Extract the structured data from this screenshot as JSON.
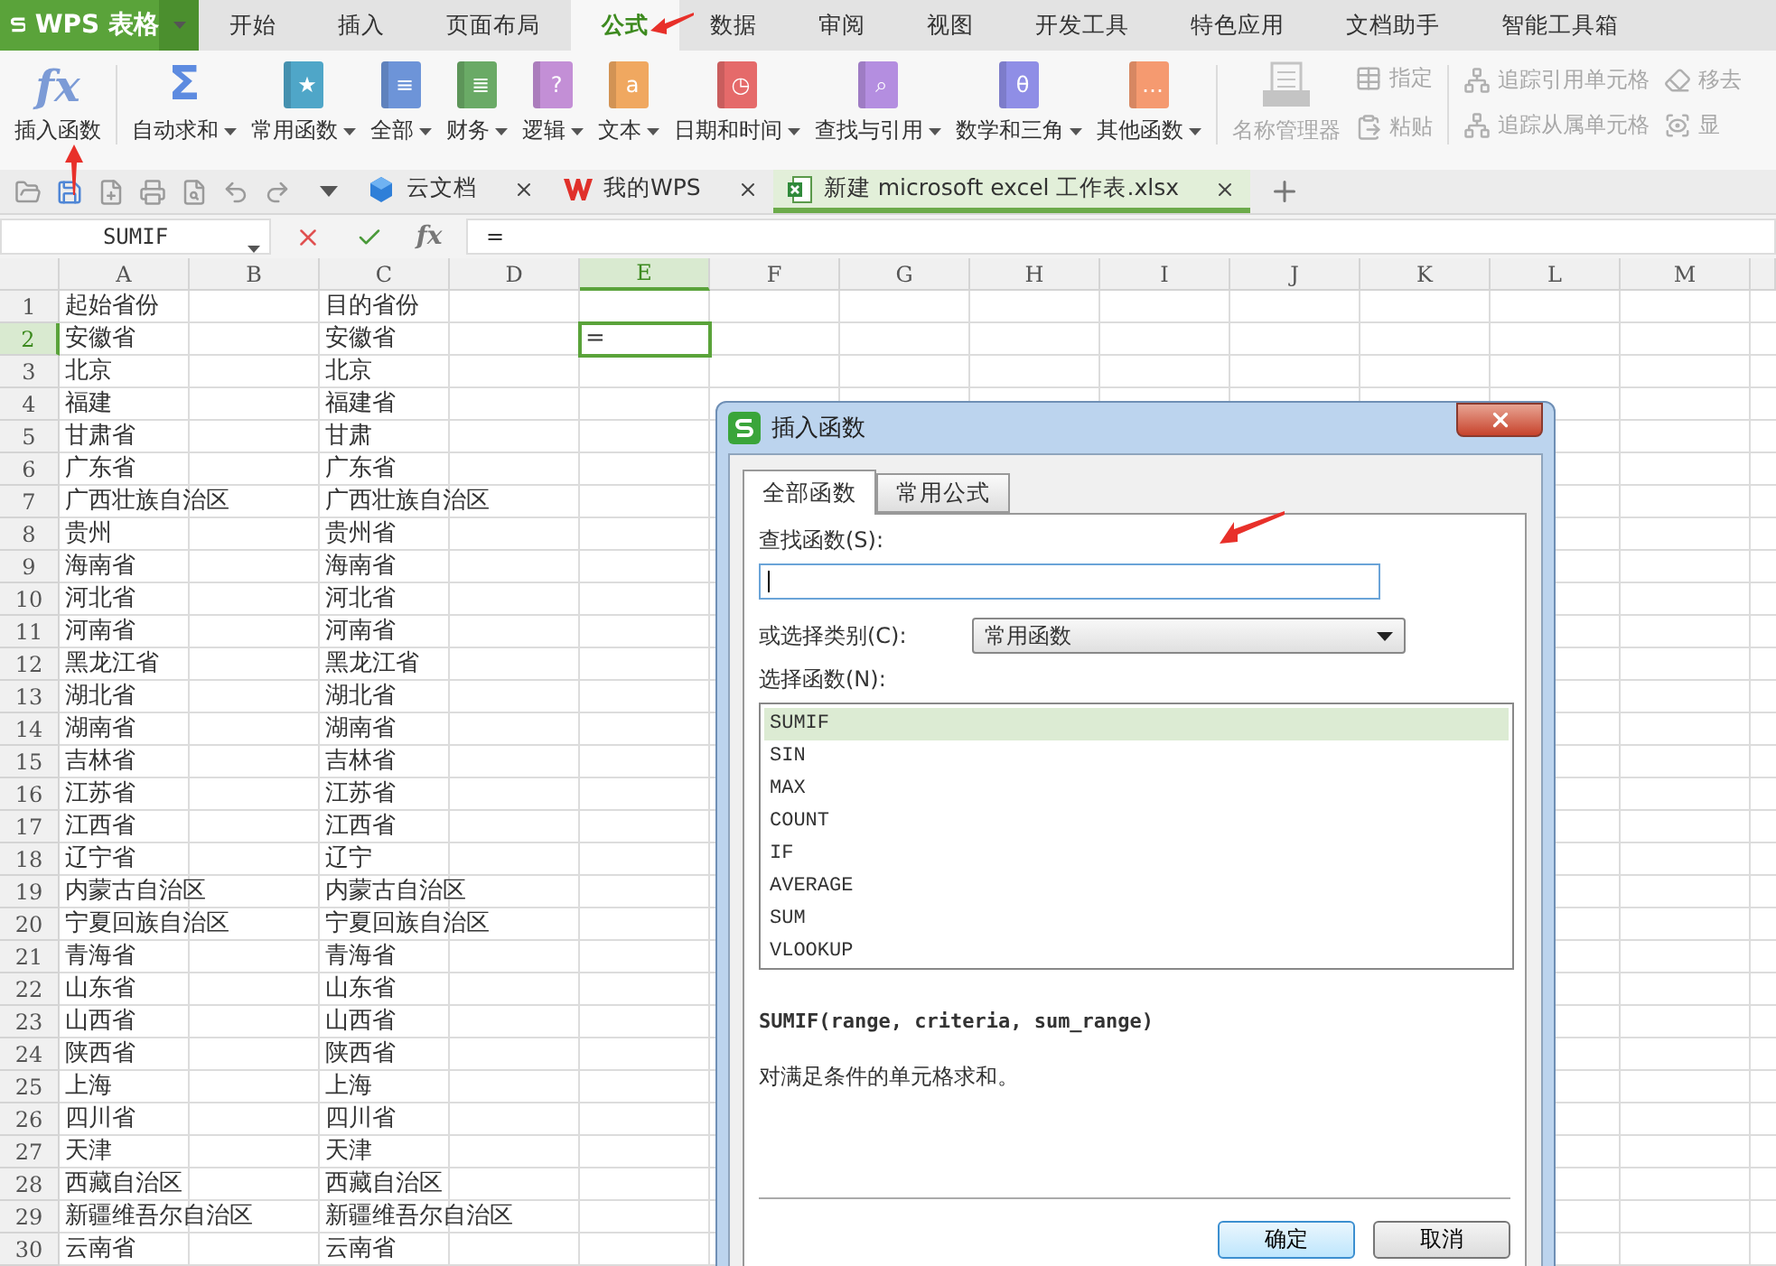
{
  "app": {
    "logo": "WPS 表格"
  },
  "menu_tabs": [
    {
      "label": "开始",
      "selected": false
    },
    {
      "label": "插入",
      "selected": false
    },
    {
      "label": "页面布局",
      "selected": false
    },
    {
      "label": "公式",
      "selected": true
    },
    {
      "label": "数据",
      "selected": false
    },
    {
      "label": "审阅",
      "selected": false
    },
    {
      "label": "视图",
      "selected": false
    },
    {
      "label": "开发工具",
      "selected": false
    },
    {
      "label": "特色应用",
      "selected": false
    },
    {
      "label": "文档助手",
      "selected": false
    },
    {
      "label": "智能工具箱",
      "selected": false
    }
  ],
  "ribbon": {
    "function_buttons": [
      {
        "label": "插入函数",
        "kind": "fx",
        "glyph": "fx",
        "menu": false
      },
      {
        "label": "自动求和",
        "kind": "sigma",
        "glyph": "Σ",
        "menu": true
      },
      {
        "label": "常用函数",
        "kind": "book",
        "glyph": "★",
        "color": "#4fa6c8",
        "menu": true
      },
      {
        "label": "全部",
        "kind": "book",
        "glyph": "≡",
        "color": "#6d94d8",
        "menu": true
      },
      {
        "label": "财务",
        "kind": "book",
        "glyph": "≣",
        "color": "#6aaa66",
        "menu": true
      },
      {
        "label": "逻辑",
        "kind": "book",
        "glyph": "?",
        "color": "#c38fd6",
        "menu": true
      },
      {
        "label": "文本",
        "kind": "book",
        "glyph": "a",
        "color": "#f0a860",
        "menu": true
      },
      {
        "label": "日期和时间",
        "kind": "book",
        "glyph": "◷",
        "color": "#e56a6a",
        "menu": true
      },
      {
        "label": "查找与引用",
        "kind": "book",
        "glyph": "⌕",
        "color": "#b48ee0",
        "menu": true
      },
      {
        "label": "数学和三角",
        "kind": "book",
        "glyph": "θ",
        "color": "#8f8ee6",
        "menu": true
      },
      {
        "label": "其他函数",
        "kind": "book",
        "glyph": "…",
        "color": "#f59a70",
        "menu": true
      }
    ],
    "name_tools": [
      {
        "label": "名称管理器",
        "kind": "large",
        "disabled": true
      },
      {
        "label": "指定",
        "kind": "small",
        "disabled": true
      },
      {
        "label": "粘贴",
        "kind": "small",
        "disabled": true
      }
    ],
    "audit_tools": [
      {
        "label": "追踪引用单元格",
        "disabled": true
      },
      {
        "label": "移去",
        "disabled": true
      },
      {
        "label": "追踪从属单元格",
        "disabled": true
      },
      {
        "label": "显",
        "disabled": true
      }
    ]
  },
  "doc_tabs": [
    {
      "label": "云文档",
      "kind": "cloud",
      "selected": false
    },
    {
      "label": "我的WPS",
      "kind": "wps",
      "selected": false
    },
    {
      "label": "新建 microsoft excel 工作表.xlsx",
      "kind": "sheet",
      "selected": true
    }
  ],
  "formula_bar": {
    "name_box": "SUMIF",
    "fx": "fx",
    "value": "="
  },
  "sheet": {
    "columns": [
      {
        "label": "A",
        "selected": false
      },
      {
        "label": "B",
        "selected": false
      },
      {
        "label": "C",
        "selected": false
      },
      {
        "label": "D",
        "selected": false
      },
      {
        "label": "E",
        "selected": true
      },
      {
        "label": "F",
        "selected": false
      },
      {
        "label": "G",
        "selected": false
      },
      {
        "label": "H",
        "selected": false
      },
      {
        "label": "I",
        "selected": false
      },
      {
        "label": "J",
        "selected": false
      },
      {
        "label": "K",
        "selected": false
      },
      {
        "label": "L",
        "selected": false
      },
      {
        "label": "M",
        "selected": false
      }
    ],
    "rows": [
      {
        "number": "1",
        "selected": false,
        "a": "起始省份",
        "c": "目的省份"
      },
      {
        "number": "2",
        "selected": true,
        "a": "安徽省",
        "c": "安徽省",
        "e": "="
      },
      {
        "number": "3",
        "selected": false,
        "a": "北京",
        "c": "北京"
      },
      {
        "number": "4",
        "selected": false,
        "a": "福建",
        "c": "福建省"
      },
      {
        "number": "5",
        "selected": false,
        "a": "甘肃省",
        "c": "甘肃"
      },
      {
        "number": "6",
        "selected": false,
        "a": "广东省",
        "c": "广东省"
      },
      {
        "number": "7",
        "selected": false,
        "a": "广西壮族自治区",
        "c": "广西壮族自治区"
      },
      {
        "number": "8",
        "selected": false,
        "a": "贵州",
        "c": "贵州省"
      },
      {
        "number": "9",
        "selected": false,
        "a": "海南省",
        "c": "海南省"
      },
      {
        "number": "10",
        "selected": false,
        "a": "河北省",
        "c": "河北省"
      },
      {
        "number": "11",
        "selected": false,
        "a": "河南省",
        "c": "河南省"
      },
      {
        "number": "12",
        "selected": false,
        "a": "黑龙江省",
        "c": "黑龙江省"
      },
      {
        "number": "13",
        "selected": false,
        "a": "湖北省",
        "c": "湖北省"
      },
      {
        "number": "14",
        "selected": false,
        "a": "湖南省",
        "c": "湖南省"
      },
      {
        "number": "15",
        "selected": false,
        "a": "吉林省",
        "c": "吉林省"
      },
      {
        "number": "16",
        "selected": false,
        "a": "江苏省",
        "c": "江苏省"
      },
      {
        "number": "17",
        "selected": false,
        "a": "江西省",
        "c": "江西省"
      },
      {
        "number": "18",
        "selected": false,
        "a": "辽宁省",
        "c": "辽宁"
      },
      {
        "number": "19",
        "selected": false,
        "a": "内蒙古自治区",
        "c": "内蒙古自治区"
      },
      {
        "number": "20",
        "selected": false,
        "a": "宁夏回族自治区",
        "c": "宁夏回族自治区"
      },
      {
        "number": "21",
        "selected": false,
        "a": "青海省",
        "c": "青海省"
      },
      {
        "number": "22",
        "selected": false,
        "a": "山东省",
        "c": "山东省"
      },
      {
        "number": "23",
        "selected": false,
        "a": "山西省",
        "c": "山西省"
      },
      {
        "number": "24",
        "selected": false,
        "a": "陕西省",
        "c": "陕西省"
      },
      {
        "number": "25",
        "selected": false,
        "a": "上海",
        "c": "上海"
      },
      {
        "number": "26",
        "selected": false,
        "a": "四川省",
        "c": "四川省"
      },
      {
        "number": "27",
        "selected": false,
        "a": "天津",
        "c": "天津"
      },
      {
        "number": "28",
        "selected": false,
        "a": "西藏自治区",
        "c": "西藏自治区"
      },
      {
        "number": "29",
        "selected": false,
        "a": "新疆维吾尔自治区",
        "c": "新疆维吾尔自治区"
      },
      {
        "number": "30",
        "selected": false,
        "a": "云南省",
        "c": "云南省"
      }
    ]
  },
  "dialog": {
    "title": "插入函数",
    "tabs": [
      {
        "label": "全部函数",
        "selected": true
      },
      {
        "label": "常用公式",
        "selected": false
      }
    ],
    "search_label": "查找函数(S):",
    "search_focused": true,
    "category_label": "或选择类别(C):",
    "category": "常用函数",
    "list_label": "选择函数(N):",
    "functions": [
      {
        "name": "SUMIF",
        "selected": true
      },
      {
        "name": "SIN",
        "selected": false
      },
      {
        "name": "MAX",
        "selected": false
      },
      {
        "name": "COUNT",
        "selected": false
      },
      {
        "name": "IF",
        "selected": false
      },
      {
        "name": "AVERAGE",
        "selected": false
      },
      {
        "name": "SUM",
        "selected": false
      },
      {
        "name": "VLOOKUP",
        "selected": false
      }
    ],
    "signature": "SUMIF(range, criteria, sum_range)",
    "description": "对满足条件的单元格求和。",
    "buttons": [
      {
        "label": "确定",
        "default": true
      },
      {
        "label": "取消",
        "default": false
      }
    ]
  }
}
